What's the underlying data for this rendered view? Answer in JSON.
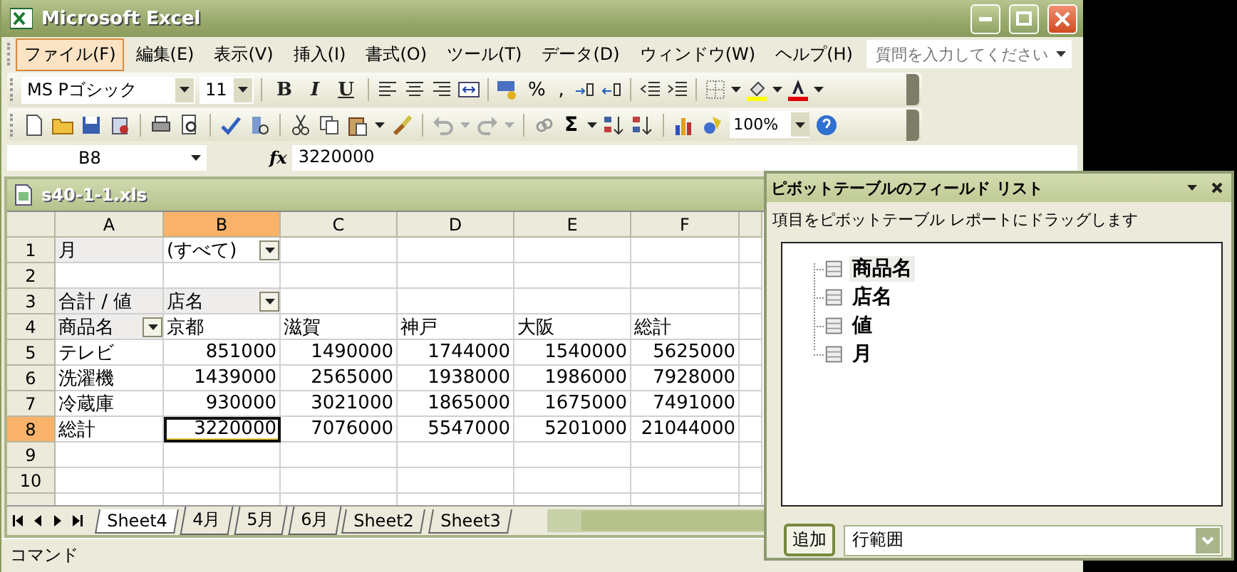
{
  "window": {
    "title": "Microsoft Excel"
  },
  "menu": [
    {
      "label": "ファイル(F)",
      "selected": true
    },
    {
      "label": "編集(E)",
      "selected": false
    },
    {
      "label": "表示(V)",
      "selected": false
    },
    {
      "label": "挿入(I)",
      "selected": false
    },
    {
      "label": "書式(O)",
      "selected": false
    },
    {
      "label": "ツール(T)",
      "selected": false
    },
    {
      "label": "データ(D)",
      "selected": false
    },
    {
      "label": "ウィンドウ(W)",
      "selected": false
    },
    {
      "label": "ヘルプ(H)",
      "selected": false
    }
  ],
  "help_search": {
    "placeholder": "質問を入力してください"
  },
  "formatting_toolbar": {
    "font": "MS Pゴシック",
    "size": "11",
    "style_buttons": [
      "B",
      "I",
      "U"
    ],
    "percent": "%",
    "comma": ","
  },
  "standard_toolbar": {
    "autosum": "Σ",
    "zoom": "100%"
  },
  "formula_bar": {
    "name_box": "B8",
    "fx": "fx",
    "value": "3220000"
  },
  "workbook": {
    "title": "s40-1-1.xls",
    "columns": [
      {
        "label": "A",
        "selected": false
      },
      {
        "label": "B",
        "selected": true
      },
      {
        "label": "C",
        "selected": false
      },
      {
        "label": "D",
        "selected": false
      },
      {
        "label": "E",
        "selected": false
      },
      {
        "label": "F",
        "selected": false
      }
    ],
    "rows": [
      {
        "header": "1",
        "selected": false,
        "cells": [
          {
            "text": "月",
            "kind": "field",
            "selected": false
          },
          {
            "text": "(すべて)",
            "kind": "page_dropdown",
            "selected": false
          }
        ]
      },
      {
        "header": "2",
        "selected": false
      },
      {
        "header": "3",
        "selected": false,
        "cells": [
          {
            "text": "合計 / 値",
            "kind": "field",
            "selected": false
          },
          {
            "text": "店名",
            "kind": "field_dropdown",
            "selected": false
          }
        ]
      },
      {
        "header": "4",
        "selected": false,
        "cells": [
          {
            "text": "商品名",
            "kind": "field_dropdown",
            "selected": false
          },
          {
            "text": "京都",
            "kind": "label",
            "selected": false
          },
          {
            "text": "滋賀",
            "kind": "label",
            "selected": false
          },
          {
            "text": "神戸",
            "kind": "label",
            "selected": false
          },
          {
            "text": "大阪",
            "kind": "label",
            "selected": false
          },
          {
            "text": "総計",
            "kind": "label",
            "selected": false
          }
        ]
      },
      {
        "header": "5",
        "selected": false,
        "cells": [
          {
            "text": "テレビ",
            "kind": "label",
            "selected": false
          },
          {
            "text": "851000",
            "kind": "number",
            "selected": false
          },
          {
            "text": "1490000",
            "kind": "number",
            "selected": false
          },
          {
            "text": "1744000",
            "kind": "number",
            "selected": false
          },
          {
            "text": "1540000",
            "kind": "number",
            "selected": false
          },
          {
            "text": "5625000",
            "kind": "number",
            "selected": false
          }
        ]
      },
      {
        "header": "6",
        "selected": false,
        "cells": [
          {
            "text": "洗濯機",
            "kind": "label",
            "selected": false
          },
          {
            "text": "1439000",
            "kind": "number",
            "selected": false
          },
          {
            "text": "2565000",
            "kind": "number",
            "selected": false
          },
          {
            "text": "1938000",
            "kind": "number",
            "selected": false
          },
          {
            "text": "1986000",
            "kind": "number",
            "selected": false
          },
          {
            "text": "7928000",
            "kind": "number",
            "selected": false
          }
        ]
      },
      {
        "header": "7",
        "selected": false,
        "cells": [
          {
            "text": "冷蔵庫",
            "kind": "label",
            "selected": false
          },
          {
            "text": "930000",
            "kind": "number",
            "selected": false
          },
          {
            "text": "3021000",
            "kind": "number",
            "selected": false
          },
          {
            "text": "1865000",
            "kind": "number",
            "selected": false
          },
          {
            "text": "1675000",
            "kind": "number",
            "selected": false
          },
          {
            "text": "7491000",
            "kind": "number",
            "selected": false
          }
        ]
      },
      {
        "header": "8",
        "selected": true,
        "cells": [
          {
            "text": "総計",
            "kind": "label",
            "selected": false
          },
          {
            "text": "3220000",
            "kind": "number",
            "selected": true
          },
          {
            "text": "7076000",
            "kind": "number",
            "selected": false
          },
          {
            "text": "5547000",
            "kind": "number",
            "selected": false
          },
          {
            "text": "5201000",
            "kind": "number",
            "selected": false
          },
          {
            "text": "21044000",
            "kind": "number",
            "selected": false
          }
        ]
      },
      {
        "header": "9",
        "selected": false
      },
      {
        "header": "10",
        "selected": false
      }
    ],
    "sheet_tabs": [
      {
        "label": "Sheet4",
        "selected": true
      },
      {
        "label": "4月",
        "selected": false
      },
      {
        "label": "5月",
        "selected": false
      },
      {
        "label": "6月",
        "selected": false
      },
      {
        "label": "Sheet2",
        "selected": false
      },
      {
        "label": "Sheet3",
        "selected": false
      }
    ]
  },
  "status_bar": {
    "text": "コマンド"
  },
  "field_list": {
    "title": "ピボットテーブルのフィールド リスト",
    "instruction": "項目をピボットテーブル レポートにドラッグします",
    "fields": [
      {
        "label": "商品名",
        "selected": true
      },
      {
        "label": "店名",
        "selected": false
      },
      {
        "label": "値",
        "selected": false
      },
      {
        "label": "月",
        "selected": false
      }
    ],
    "add_button": "追加",
    "area": "行範囲"
  }
}
